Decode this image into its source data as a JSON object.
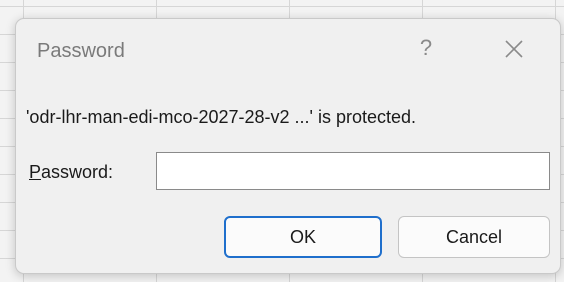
{
  "dialog": {
    "title": "Password",
    "help_glyph": "?",
    "close_icon": "close-icon",
    "message": "'odr-lhr-man-edi-mco-2027-28-v2 ...' is protected.",
    "password_label_mnemonic": "P",
    "password_label_rest": "assword:",
    "password_value": "",
    "ok_label": "OK",
    "cancel_label": "Cancel"
  },
  "colors": {
    "dialog_bg": "#f0f0f0",
    "default_button_border": "#1f6fcc"
  }
}
